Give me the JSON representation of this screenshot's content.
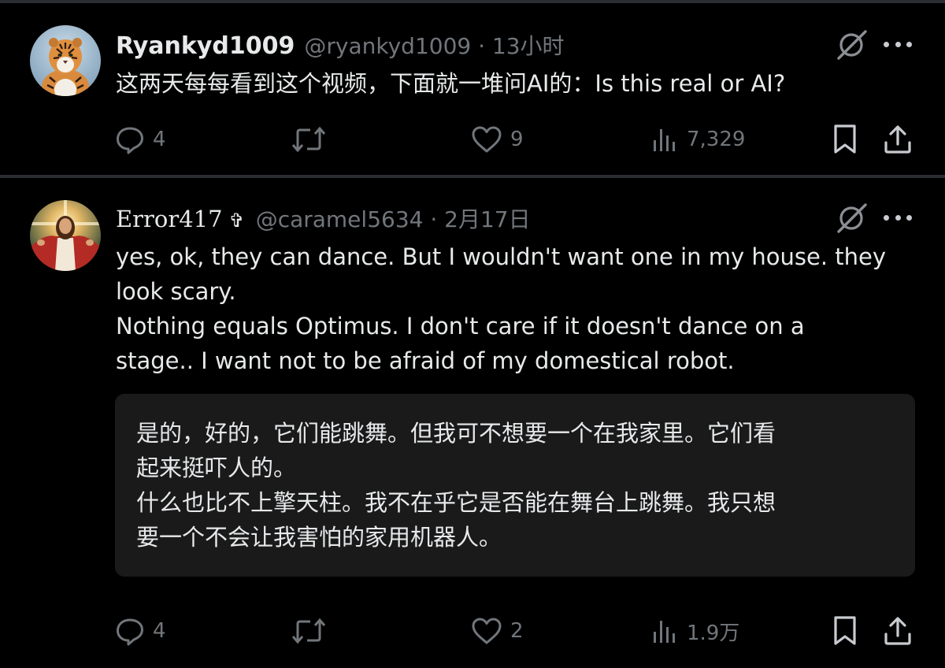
{
  "posts": [
    {
      "display_name": "Ryankyd1009",
      "handle_and_time": "@ryankyd1009 · 13小时",
      "text_lines": [
        "这两天每每看到这个视频，下面就一堆问AI的：Is this real or AI?"
      ],
      "stats": {
        "replies": "4",
        "likes": "9",
        "views": "7,329"
      }
    },
    {
      "display_name": "Error417",
      "badge": "✞",
      "handle_and_time": "@caramel5634 · 2月17日",
      "text_lines": [
        "yes, ok, they can dance. But I wouldn't want one in my house. they",
        "look scary.",
        "Nothing equals Optimus. I don't care if it doesn't dance on a",
        "stage.. I want not to be afraid of my domestical robot."
      ],
      "translation_lines": [
        "是的，好的，它们能跳舞。但我可不想要一个在我家里。它们看",
        "起来挺吓人的。",
        "什么也比不上擎天柱。我不在乎它是否能在舞台上跳舞。我只想",
        "要一个不会让我害怕的家用机器人。"
      ],
      "stats": {
        "replies": "4",
        "likes": "2",
        "views": "1.9万"
      }
    }
  ],
  "icons": {
    "reply": "reply-icon",
    "retweet": "retweet-icon",
    "like": "heart-icon",
    "views": "views-bar-chart-icon",
    "bookmark": "bookmark-icon",
    "share": "share-upload-icon",
    "grok": "grok-slash-circle-icon",
    "more": "more-dots-icon"
  },
  "colors": {
    "background": "#000000",
    "text_primary": "#e7e9ea",
    "text_secondary": "#71767b",
    "translation_box": "#1a1a1b",
    "divider": "#2a2d31"
  }
}
